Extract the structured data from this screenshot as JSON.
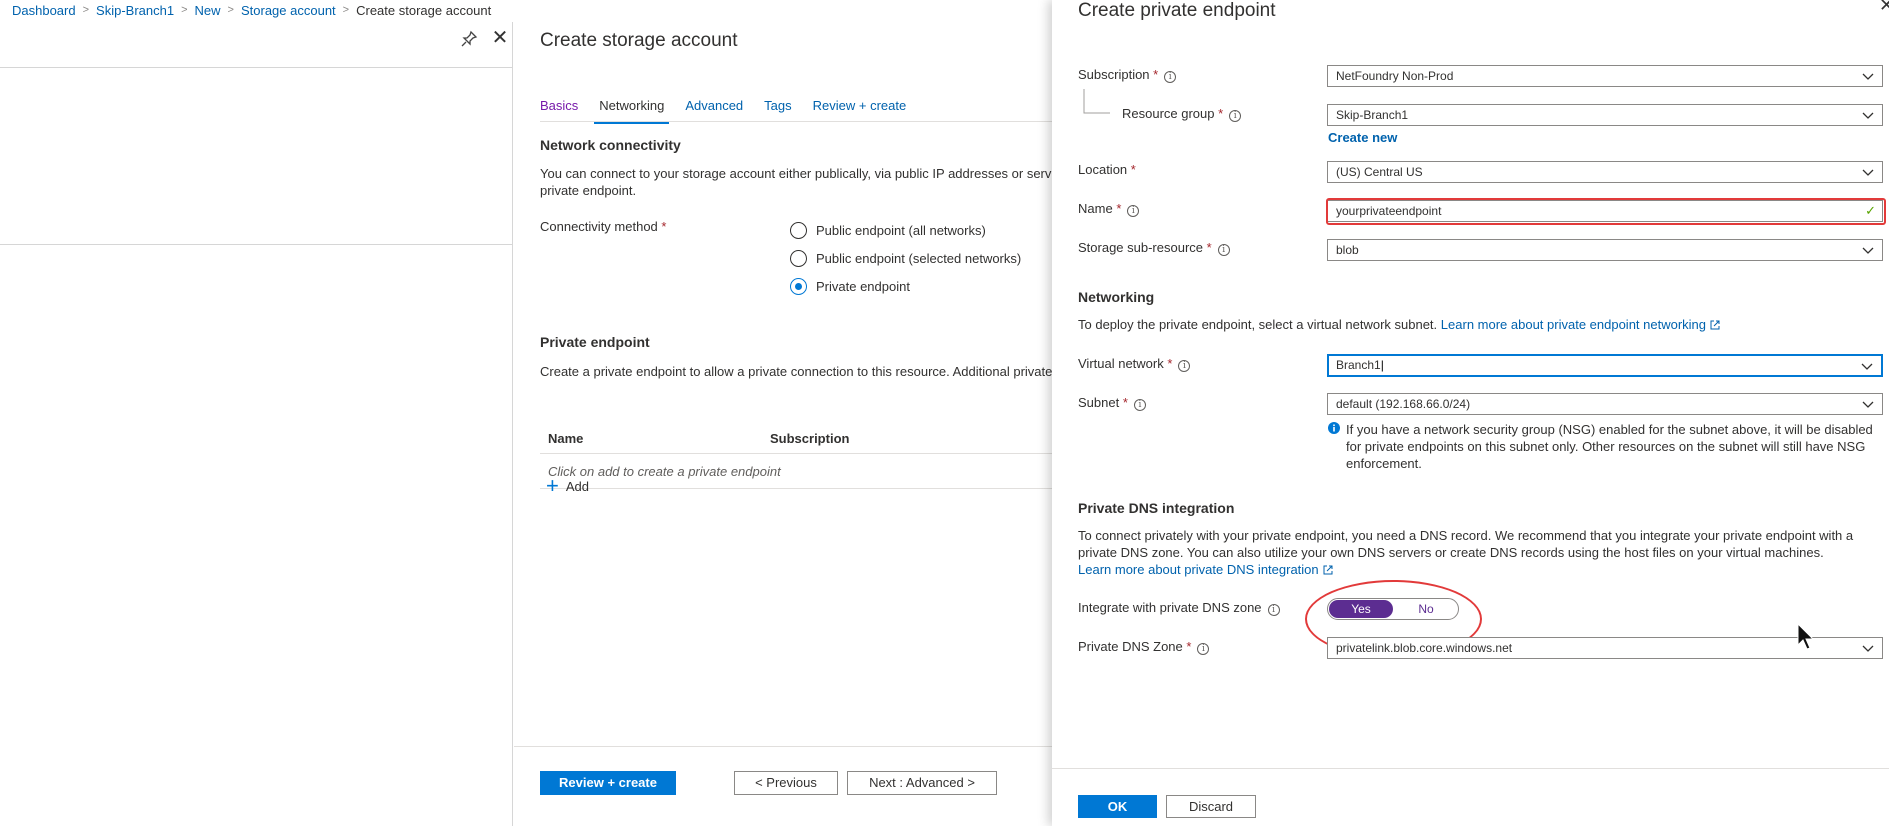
{
  "breadcrumb": {
    "items": [
      "Dashboard",
      "Skip-Branch1",
      "New",
      "Storage account"
    ],
    "current": "Create storage account"
  },
  "storage": {
    "title": "Create storage account",
    "tabs": [
      "Basics",
      "Networking",
      "Advanced",
      "Tags",
      "Review + create"
    ],
    "active_tab": "Networking",
    "network_connectivity_heading": "Network connectivity",
    "network_connectivity_text": "You can connect to your storage account either publically, via public IP addresses or servic private endpoint.",
    "connectivity_label": "Connectivity method",
    "connectivity_options": [
      "Public endpoint (all networks)",
      "Public endpoint (selected networks)",
      "Private endpoint"
    ],
    "connectivity_selected": "Private endpoint",
    "private_endpoint_heading": "Private endpoint",
    "private_endpoint_text": "Create a private endpoint to allow a private connection to this resource. Additional private",
    "grid_columns": [
      "Name",
      "Subscription"
    ],
    "grid_empty": "Click on add to create a private endpoint",
    "add_label": "Add",
    "buttons": {
      "review_create": "Review + create",
      "previous": "< Previous",
      "next": "Next : Advanced >"
    }
  },
  "endpoint": {
    "title": "Create private endpoint",
    "subscription_label": "Subscription",
    "subscription_value": "NetFoundry Non-Prod",
    "resource_group_label": "Resource group",
    "resource_group_value": "Skip-Branch1",
    "create_new": "Create new",
    "location_label": "Location",
    "location_value": "(US) Central US",
    "name_label": "Name",
    "name_value": "yourprivateendpoint",
    "subresource_label": "Storage sub-resource",
    "subresource_value": "blob",
    "networking_heading": "Networking",
    "networking_text": "To deploy the private endpoint, select a virtual network subnet.",
    "networking_link": "Learn more about private endpoint networking",
    "vnet_label": "Virtual network",
    "vnet_value": "Branch1",
    "subnet_label": "Subnet",
    "subnet_value": "default (192.168.66.0/24)",
    "nsg_info": "If you have a network security group (NSG) enabled for the subnet above, it will be disabled for private endpoints on this subnet only. Other resources on the subnet will still have NSG enforcement.",
    "dns_heading": "Private DNS integration",
    "dns_text": "To connect privately with your private endpoint, you need a DNS record. We recommend that you integrate your private endpoint with a private DNS zone. You can also utilize your own DNS servers or create DNS records using the host files on your virtual machines.",
    "dns_link": "Learn more about private DNS integration",
    "integrate_label": "Integrate with private DNS zone",
    "toggle_yes": "Yes",
    "toggle_no": "No",
    "toggle_selected": "Yes",
    "dns_zone_label": "Private DNS Zone",
    "dns_zone_value": "privatelink.blob.core.windows.net",
    "ok": "OK",
    "discard": "Discard"
  },
  "colors": {
    "accent": "#0078d4",
    "link": "#0062ad",
    "toggle_on": "#5c2d91",
    "annotation": "#e23a3a",
    "required": "#a4262c"
  }
}
